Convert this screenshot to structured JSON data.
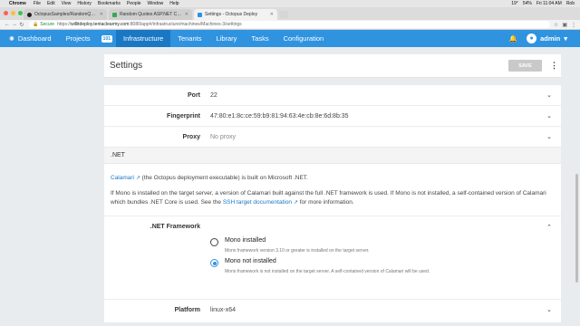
{
  "macos": {
    "app": "Chrome",
    "menus": [
      "File",
      "Edit",
      "View",
      "History",
      "Bookmarks",
      "People",
      "Window",
      "Help"
    ],
    "status": {
      "temp": "19°",
      "battery": "54%",
      "clock": "Fri 11:04 AM",
      "user": "Rob"
    }
  },
  "browser": {
    "tabs": [
      {
        "title": "OctopusSamples/RandomQuotes-Java",
        "active": false,
        "icon": "github-icon"
      },
      {
        "title": "Random Quotes ASP.NET Core",
        "active": false,
        "icon": "page-icon"
      },
      {
        "title": "Settings - Octopus Deploy",
        "active": true,
        "icon": "octopus-icon"
      }
    ],
    "secure_label": "Secure",
    "url_scheme": "https://",
    "url_host": "willitdeploy.tentaclearmy.com",
    "url_path": ":8080/app#/infrastructure/machines/Machines-3/settings"
  },
  "nav": {
    "items": [
      {
        "label": "Dashboard",
        "icon": "octopus-icon",
        "active": false
      },
      {
        "label": "Projects",
        "active": false
      },
      {
        "label": "Infrastructure",
        "active": true
      },
      {
        "label": "Tenants",
        "active": false
      },
      {
        "label": "Library",
        "active": false
      },
      {
        "label": "Tasks",
        "active": false
      },
      {
        "label": "Configuration",
        "active": false
      }
    ],
    "badge": "101",
    "user": "admin"
  },
  "page": {
    "title": "Settings",
    "save_label": "SAVE"
  },
  "fields": {
    "port": {
      "label": "Port",
      "value": "22"
    },
    "fingerprint": {
      "label": "Fingerprint",
      "value": "47:80:e1:8c:ce:59:b9:81:94:63:4e:cb:8e:6d:8b:35"
    },
    "proxy": {
      "label": "Proxy",
      "value": "No proxy"
    }
  },
  "dotnet": {
    "section_title": ".NET",
    "calamari_link": "Calamari",
    "calamari_text": " (the Octopus deployment executable) is built on Microsoft .NET.",
    "mono_text_1": "If Mono is installed on the target server, a version of Calamari built against the full .NET framework is used. If Mono is not installed, a self-contained version of Calamari which bundles .NET Core is used. See the ",
    "ssh_link": "SSH target documentation",
    "mono_text_2": " for more information.",
    "framework_label": ".NET Framework",
    "options": [
      {
        "label": "Mono installed",
        "desc": "Mono framework version 3.10 or greater is installed on the target server.",
        "checked": false
      },
      {
        "label": "Mono not installed",
        "desc": "Mono framework is not installed on the target server. A self-contained version of Calamari will be used.",
        "checked": true
      }
    ]
  },
  "platform": {
    "label": "Platform",
    "value": "linux-x64"
  },
  "colors": {
    "brand": "#2f93e0",
    "nav_active": "#1a77c4",
    "save_disabled": "#c9c9c9"
  }
}
